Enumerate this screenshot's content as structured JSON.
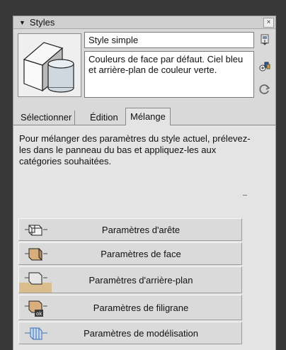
{
  "titlebar": {
    "title": "Styles",
    "collapse_icon": "triangle-down",
    "close_label": "×"
  },
  "style": {
    "name": "Style simple",
    "description": "Couleurs de face par défaut. Ciel bleu et arrière-plan de couleur verte."
  },
  "tabs": [
    {
      "label": "Sélectionner",
      "active": false
    },
    {
      "label": "Édition",
      "active": false
    },
    {
      "label": "Mélange",
      "active": true
    }
  ],
  "mix": {
    "instructions": "Pour mélanger des paramètres du style actuel, prélevez-les dans le panneau du bas et appliquez-les aux catégories souhaitées.",
    "buttons": [
      {
        "label": "Paramètres d'arête",
        "icon": "edge-settings-icon"
      },
      {
        "label": "Paramètres de face",
        "icon": "face-settings-icon"
      },
      {
        "label": "Paramètres d'arrière-plan",
        "icon": "background-settings-icon"
      },
      {
        "label": "Paramètres de filigrane",
        "icon": "watermark-settings-icon"
      },
      {
        "label": "Paramètres de modélisation",
        "icon": "modeling-settings-icon"
      }
    ]
  },
  "colors": {
    "panel": "#d9d9d9",
    "frame": "#383838",
    "accent_blue": "#3a6fb0"
  }
}
